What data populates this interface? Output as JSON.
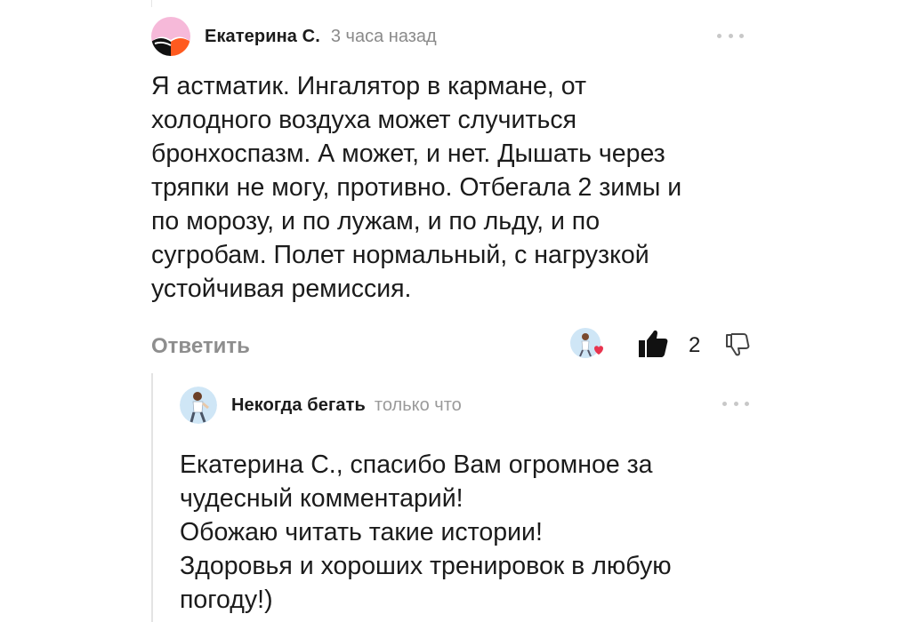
{
  "comment": {
    "author": "Екатерина С.",
    "time": "3 часа назад",
    "avatar_icon": "pink-orange-abstract-avatar",
    "text_lines": [
      "Я астматик. Ингалятор в кармане, от",
      "холодного воздуха может случиться",
      "бронхоспазм. А может, и нет. Дышать через",
      "тряпки не могу, противно. Отбегала 2 зимы и",
      "по морозу, и по лужам, и по льду, и по",
      "сугробам. Полет нормальный, с нагрузкой",
      "устойчивая ремиссия."
    ],
    "reply_label": "Ответить",
    "liker_icon": "runner-avatar-with-heart-icon",
    "like_icon": "thumbs-up-icon",
    "like_count": "2",
    "dislike_icon": "thumbs-down-icon",
    "more_icon": "more-dots-icon"
  },
  "reply": {
    "author": "Некогда бегать",
    "time": "только что",
    "avatar_icon": "runner-avatar",
    "text_lines": [
      "Екатерина С., спасибо Вам огромное за",
      "чудесный комментарий!",
      "Обожаю читать такие истории!",
      "Здоровья и хороших тренировок в любую",
      "погоду!)"
    ],
    "more_icon": "more-dots-icon"
  },
  "colors": {
    "text": "#1b1b1b",
    "muted": "#8a8a8a",
    "avatar_pink": "#f6b9d9",
    "avatar_orange": "#ff5a1f",
    "heart": "#e8344e",
    "runner_bg": "#cfe6f6"
  }
}
